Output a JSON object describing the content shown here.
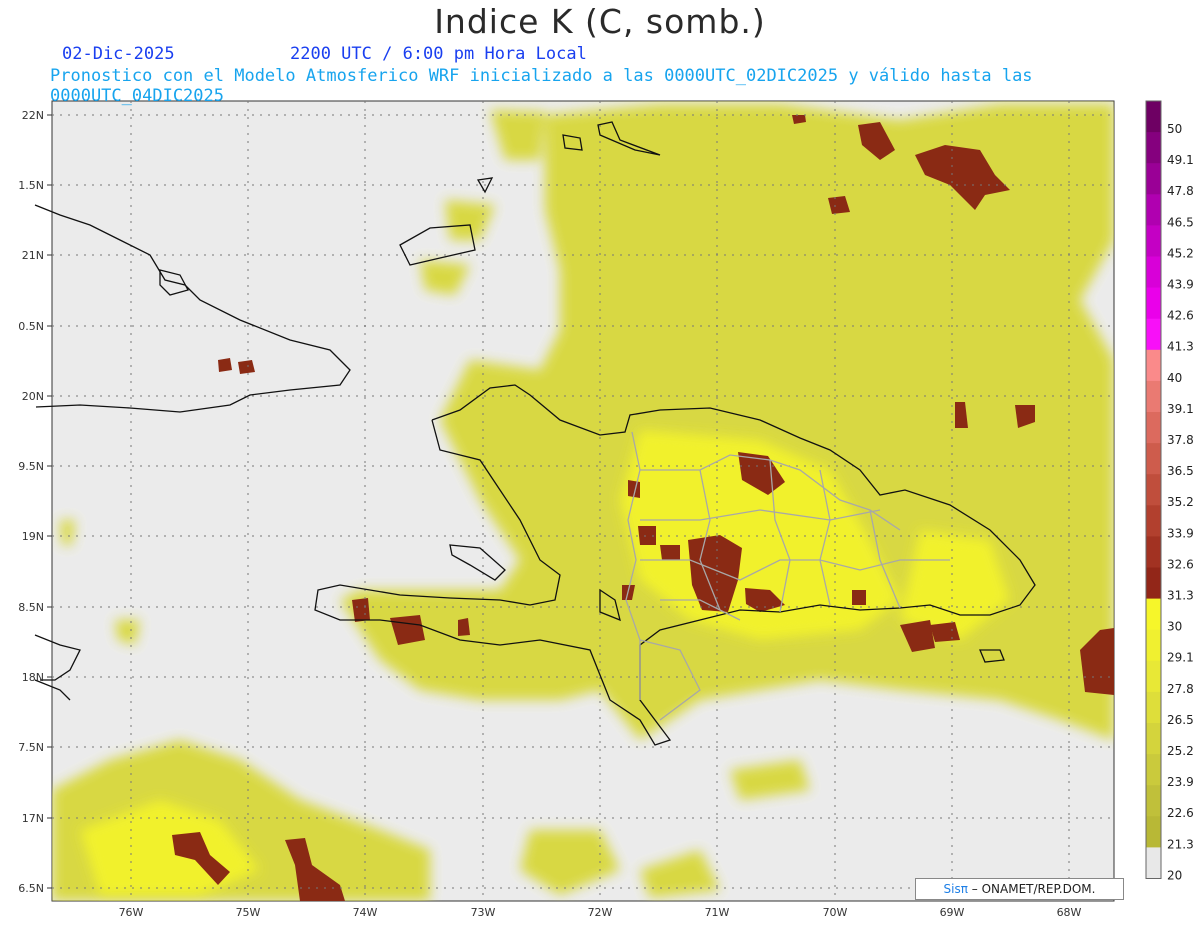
{
  "header": {
    "title": "Indice K (C, somb.)",
    "date": "02-Dic-2025",
    "time": "2200 UTC / 6:00 pm Hora Local",
    "description": "Pronostico con el Modelo Atmosferico WRF inicializado a las 0000UTC_02DIC2025 y válido hasta las  0000UTC_04DIC2025"
  },
  "map": {
    "lat_labels": [
      "22N",
      "1.5N",
      "21N",
      "0.5N",
      "20N",
      "9.5N",
      "19N",
      "8.5N",
      "18N",
      "7.5N",
      "17N",
      "6.5N"
    ],
    "lon_labels": [
      "76W",
      "75W",
      "74W",
      "73W",
      "72W",
      "71W",
      "70W",
      "69W",
      "68W"
    ],
    "background_color": "#ebebeb"
  },
  "colorbar": {
    "levels": [
      "50",
      "49.1",
      "47.8",
      "46.5",
      "45.2",
      "43.9",
      "42.6",
      "41.3",
      "40",
      "39.1",
      "37.8",
      "36.5",
      "35.2",
      "33.9",
      "32.6",
      "31.3",
      "30",
      "29.1",
      "27.8",
      "26.5",
      "25.2",
      "23.9",
      "22.6",
      "21.3",
      "20"
    ],
    "colors": [
      "#6e0063",
      "#85007e",
      "#9a0096",
      "#b000b0",
      "#c400c4",
      "#d800d8",
      "#ea00ea",
      "#f810f8",
      "#fa8a8a",
      "#ea7a72",
      "#dc6a5e",
      "#ce5c4c",
      "#c04e3c",
      "#b2402e",
      "#a23222",
      "#922618",
      "#f6f62a",
      "#f0f030",
      "#e8e836",
      "#dede3a",
      "#d4d43c",
      "#caca3c",
      "#c0c03a",
      "#b8b836",
      "#e8e8e8"
    ]
  },
  "credit": {
    "brand": "Sisπ",
    "text": "– ONAMET/REP.DOM."
  }
}
